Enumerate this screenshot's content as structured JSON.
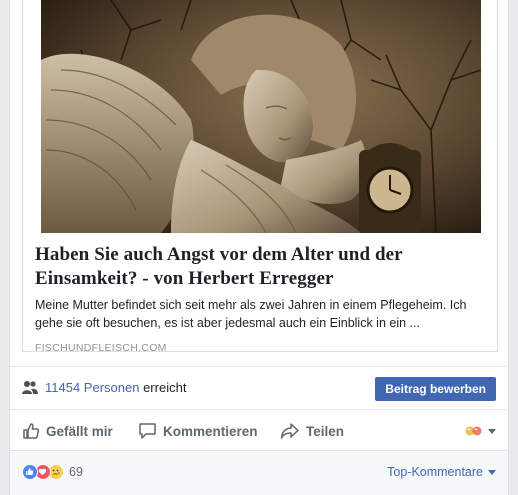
{
  "link_preview": {
    "image_alt": "Angel statue resting head on hand next to a clock",
    "title": "Haben Sie auch Angst vor dem Alter und der Einsamkeit? - von Herbert Erregger",
    "description": "Meine Mutter befindet sich seit mehr als zwei Jahren in einem Pflegeheim. Ich gehe sie oft besuchen, es ist aber jedesmal auch ein Einblick in ein ...",
    "domain": "FISCHUNDFLEISCH.COM"
  },
  "reach": {
    "count_label": "11454 Personen",
    "suffix": "erreicht",
    "boost_label": "Beitrag bewerben"
  },
  "actions": {
    "like_label": "Gefällt mir",
    "comment_label": "Kommentieren",
    "share_label": "Teilen"
  },
  "reactions": {
    "types": [
      "like",
      "love",
      "sad"
    ],
    "count": "69",
    "sort_label": "Top-Kommentare"
  },
  "colors": {
    "link_blue": "#4267b2",
    "like_blue": "#4e83f4",
    "love_red": "#f25268",
    "sad_yellow": "#f6cd52"
  }
}
